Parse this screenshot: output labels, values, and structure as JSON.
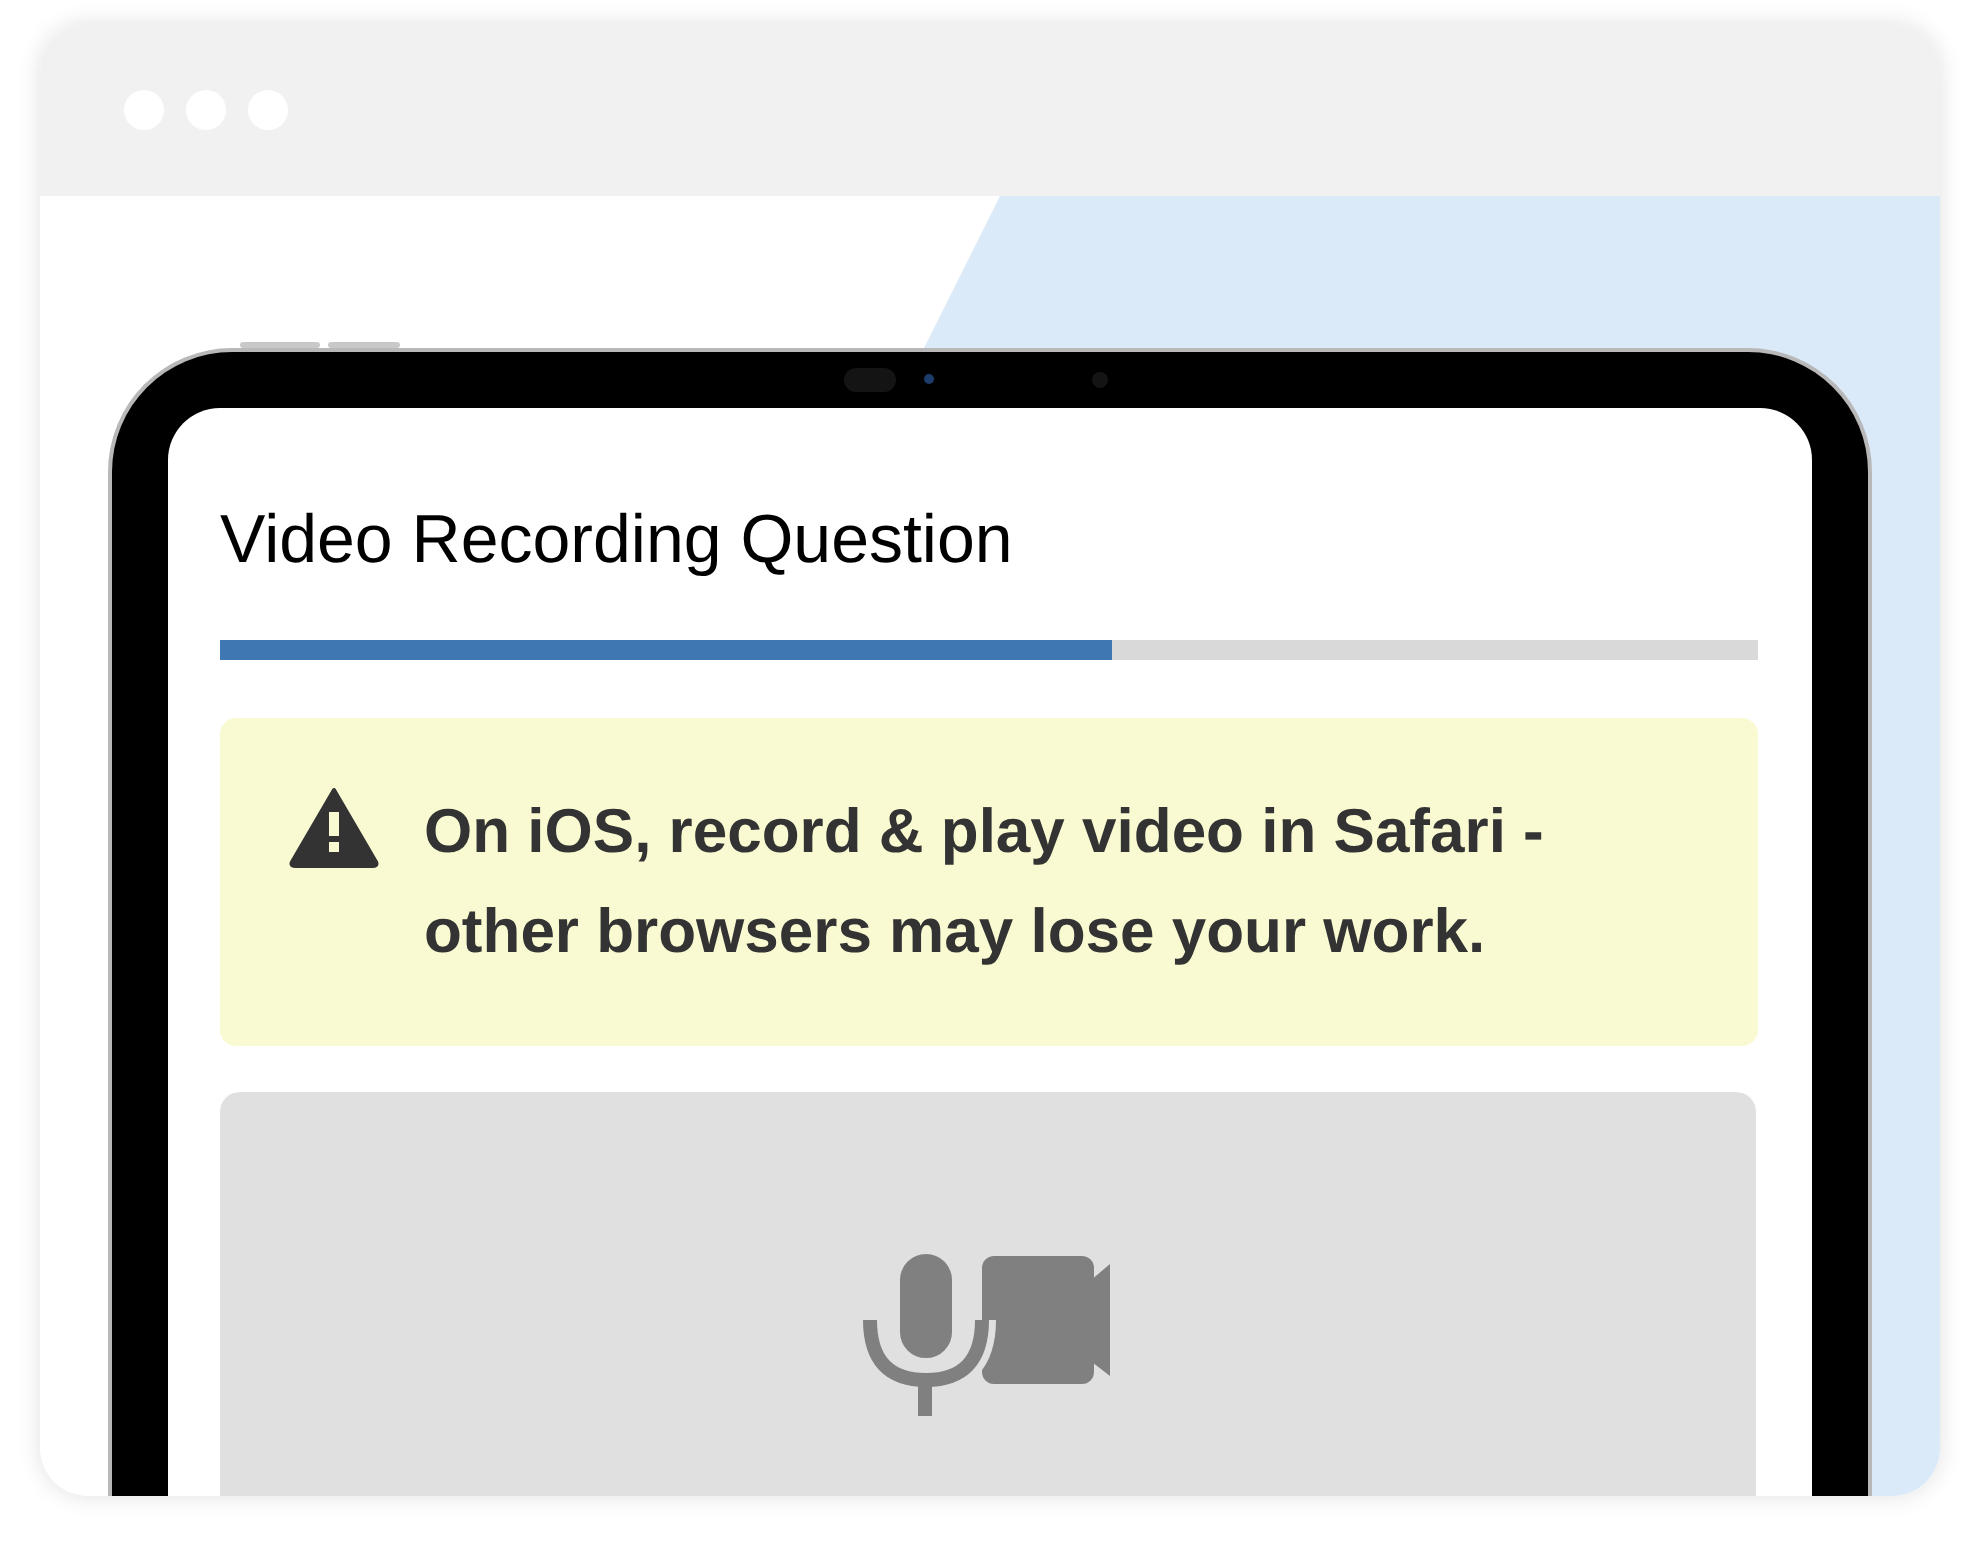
{
  "question": {
    "title": "Video Recording Question"
  },
  "progress": {
    "level": 0.58
  },
  "alert": {
    "kind": "warning",
    "text": "On iOS, record & play video in Safari - other browsers may lose your work."
  },
  "recorder": {
    "kind": "video"
  }
}
